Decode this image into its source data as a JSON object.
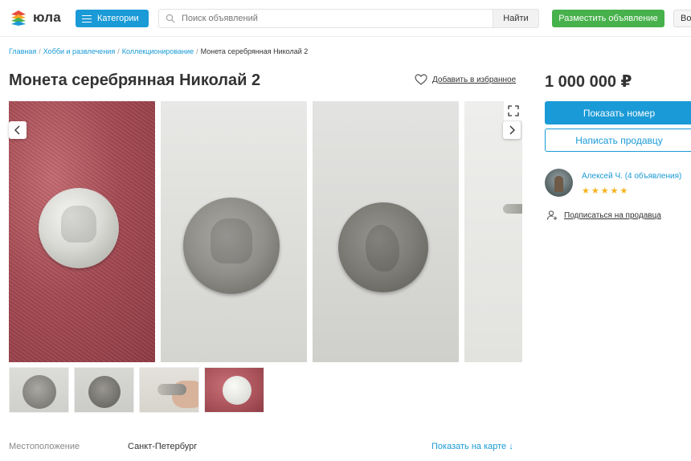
{
  "header": {
    "logo_text": "юла",
    "categories_label": "Категории",
    "search_placeholder": "Поиск объявлений",
    "search_button": "Найти",
    "post_ad_label": "Разместить объявление",
    "login_label": "Во"
  },
  "breadcrumb": {
    "items": [
      "Главная",
      "Хобби и развлечения",
      "Коллекционирование"
    ],
    "current": "Монета серебрянная Николай 2",
    "separator": "/"
  },
  "listing": {
    "title": "Монета серебрянная Николай 2",
    "favorite_label": "Добавить в избранное",
    "price": "1 000 000 ₽",
    "show_number_label": "Показать номер",
    "write_seller_label": "Написать продавцу"
  },
  "seller": {
    "name": "Алексей Ч. (4 объявления)",
    "rating_stars": 5,
    "subscribe_label": "Подписаться на продавца"
  },
  "gallery": {
    "prev_icon": "chevron-left-icon",
    "next_icon": "chevron-right-icon",
    "fullscreen_icon": "expand-icon",
    "thumbnail_count": 4
  },
  "location": {
    "label": "Местоположение",
    "value": "Санкт-Петербург",
    "map_link": "Показать на карте ↓"
  },
  "colors": {
    "primary": "#1a9ad6",
    "post_button": "#47b14b",
    "star": "#f6b21b"
  }
}
